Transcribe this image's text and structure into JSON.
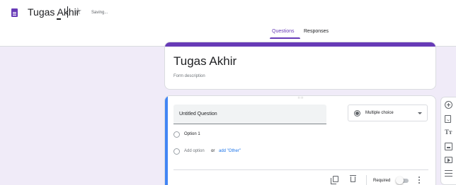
{
  "header": {
    "doc_icon": "form-doc-icon",
    "title": "Tugas Akhir",
    "star_icon": "star-outline-icon",
    "status": "Saving..."
  },
  "tabs": [
    {
      "label": "Questions",
      "active": true
    },
    {
      "label": "Responses",
      "active": false
    }
  ],
  "form": {
    "title": "Tugas Akhir",
    "description_placeholder": "Form description"
  },
  "question": {
    "title": "Untitled Question",
    "type": "Multiple choice",
    "options": [
      {
        "label": "Option 1"
      }
    ],
    "add_option_label": "Add option",
    "or_label": "or",
    "add_other_label": "add \"Other\"",
    "required_label": "Required",
    "required": false
  },
  "toolbox": {
    "items": [
      "add-question-icon",
      "import-questions-icon",
      "add-title-icon",
      "add-image-icon",
      "add-video-icon",
      "add-section-icon"
    ]
  },
  "colors": {
    "accent": "#673ab7",
    "background": "#f0ebf8",
    "active_card": "#4285f4",
    "link": "#1a73e8"
  }
}
